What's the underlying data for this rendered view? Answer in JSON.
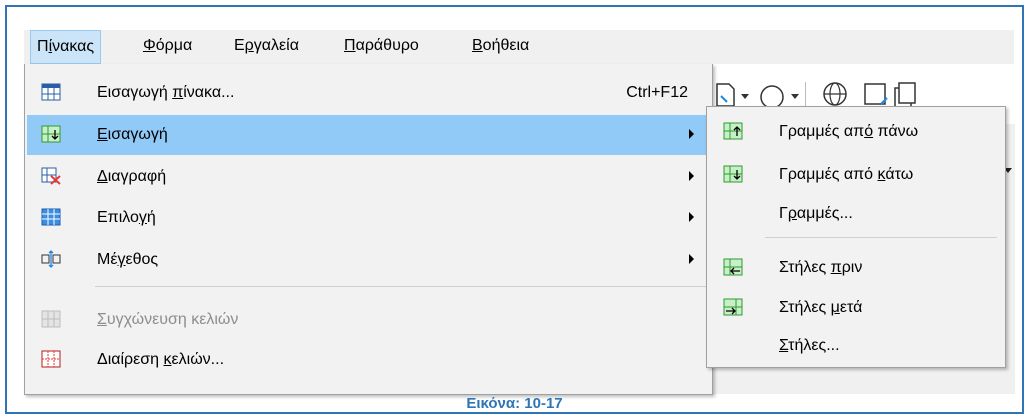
{
  "menubar": {
    "items": [
      {
        "pre": "Π",
        "ul": "ί",
        "post": "νακας"
      },
      {
        "pre": "",
        "ul": "Φ",
        "post": "όρμα"
      },
      {
        "pre": "Ε",
        "ul": "ρ",
        "post": "γαλεία"
      },
      {
        "pre": "",
        "ul": "Π",
        "post": "αράθυρο"
      },
      {
        "pre": "",
        "ul": "Β",
        "post": "οήθεια"
      }
    ]
  },
  "table_menu": {
    "items": [
      {
        "pre": "Εισαγωγή ",
        "ul": "π",
        "post": "ίνακα...",
        "shortcut": "Ctrl+F12",
        "icon": "insert-table-icon"
      },
      {
        "pre": "",
        "ul": "Ε",
        "post": "ισαγωγή",
        "icon": "insert-rows-icon"
      },
      {
        "pre": "",
        "ul": "Δ",
        "post": "ιαγραφή",
        "icon": "delete-table-icon"
      },
      {
        "pre": "Επιλο",
        "ul": "γ",
        "post": "ή",
        "icon": "select-table-icon"
      },
      {
        "pre": "Μέ",
        "ul": "γ",
        "post": "εθος",
        "icon": "size-icon"
      },
      {
        "pre": "",
        "ul": "Σ",
        "post": "υγχώνευση κελιών",
        "icon": "merge-cells-icon"
      },
      {
        "pre": "Διαίρεση ",
        "ul": "κ",
        "post": "ελιών...",
        "icon": "split-cells-icon"
      }
    ]
  },
  "insert_submenu": {
    "items": [
      {
        "pre": "Γραμμές απ",
        "ul": "ό",
        "post": " πάνω",
        "icon": "rows-above-icon"
      },
      {
        "pre": "Γραμμές από ",
        "ul": "κ",
        "post": "άτω",
        "icon": "rows-below-icon"
      },
      {
        "pre": "Γ",
        "ul": "ρ",
        "post": "αμμές...",
        "icon": ""
      },
      {
        "pre": "Στήλες ",
        "ul": "π",
        "post": "ριν",
        "icon": "columns-before-icon"
      },
      {
        "pre": "Στήλες ",
        "ul": "μ",
        "post": "ετά",
        "icon": "columns-after-icon"
      },
      {
        "pre": "",
        "ul": "Σ",
        "post": "τήλες...",
        "icon": ""
      }
    ]
  },
  "caption": "Εικόνα: 10-17"
}
